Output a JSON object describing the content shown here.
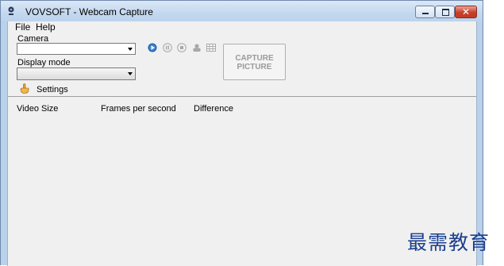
{
  "window": {
    "title": "VOVSOFT - Webcam Capture"
  },
  "menu": {
    "file": "File",
    "help": "Help"
  },
  "camera": {
    "label": "Camera",
    "value": ""
  },
  "display_mode": {
    "label": "Display mode",
    "value": ""
  },
  "controls": {
    "capture_line1": "CAPTURE",
    "capture_line2": "PICTURE",
    "settings_label": "Settings"
  },
  "info": {
    "video_size": "Video Size",
    "fps": "Frames per second",
    "difference": "Difference"
  },
  "watermark": "最需教育",
  "colors": {
    "accent_blue": "#1f5fa8",
    "disabled_gray": "#9a9a9a"
  }
}
